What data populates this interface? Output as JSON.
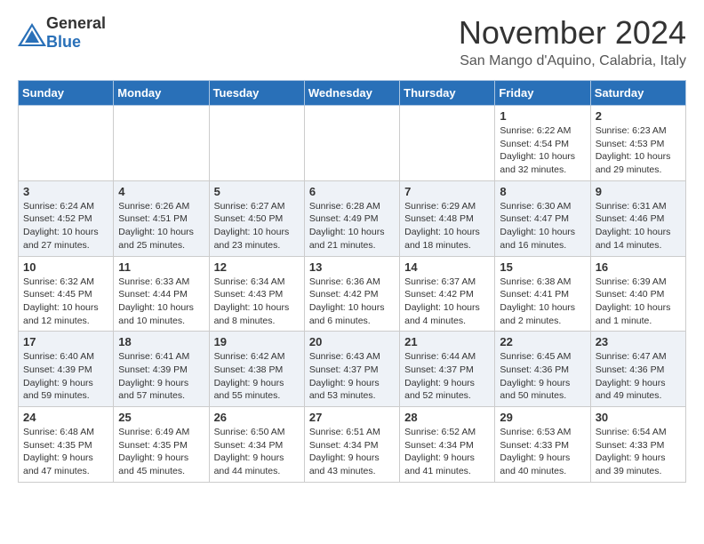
{
  "header": {
    "logo_general": "General",
    "logo_blue": "Blue",
    "month_title": "November 2024",
    "location": "San Mango d'Aquino, Calabria, Italy"
  },
  "calendar": {
    "columns": [
      "Sunday",
      "Monday",
      "Tuesday",
      "Wednesday",
      "Thursday",
      "Friday",
      "Saturday"
    ],
    "rows": [
      [
        {
          "day": "",
          "detail": ""
        },
        {
          "day": "",
          "detail": ""
        },
        {
          "day": "",
          "detail": ""
        },
        {
          "day": "",
          "detail": ""
        },
        {
          "day": "",
          "detail": ""
        },
        {
          "day": "1",
          "detail": "Sunrise: 6:22 AM\nSunset: 4:54 PM\nDaylight: 10 hours and 32 minutes."
        },
        {
          "day": "2",
          "detail": "Sunrise: 6:23 AM\nSunset: 4:53 PM\nDaylight: 10 hours and 29 minutes."
        }
      ],
      [
        {
          "day": "3",
          "detail": "Sunrise: 6:24 AM\nSunset: 4:52 PM\nDaylight: 10 hours and 27 minutes."
        },
        {
          "day": "4",
          "detail": "Sunrise: 6:26 AM\nSunset: 4:51 PM\nDaylight: 10 hours and 25 minutes."
        },
        {
          "day": "5",
          "detail": "Sunrise: 6:27 AM\nSunset: 4:50 PM\nDaylight: 10 hours and 23 minutes."
        },
        {
          "day": "6",
          "detail": "Sunrise: 6:28 AM\nSunset: 4:49 PM\nDaylight: 10 hours and 21 minutes."
        },
        {
          "day": "7",
          "detail": "Sunrise: 6:29 AM\nSunset: 4:48 PM\nDaylight: 10 hours and 18 minutes."
        },
        {
          "day": "8",
          "detail": "Sunrise: 6:30 AM\nSunset: 4:47 PM\nDaylight: 10 hours and 16 minutes."
        },
        {
          "day": "9",
          "detail": "Sunrise: 6:31 AM\nSunset: 4:46 PM\nDaylight: 10 hours and 14 minutes."
        }
      ],
      [
        {
          "day": "10",
          "detail": "Sunrise: 6:32 AM\nSunset: 4:45 PM\nDaylight: 10 hours and 12 minutes."
        },
        {
          "day": "11",
          "detail": "Sunrise: 6:33 AM\nSunset: 4:44 PM\nDaylight: 10 hours and 10 minutes."
        },
        {
          "day": "12",
          "detail": "Sunrise: 6:34 AM\nSunset: 4:43 PM\nDaylight: 10 hours and 8 minutes."
        },
        {
          "day": "13",
          "detail": "Sunrise: 6:36 AM\nSunset: 4:42 PM\nDaylight: 10 hours and 6 minutes."
        },
        {
          "day": "14",
          "detail": "Sunrise: 6:37 AM\nSunset: 4:42 PM\nDaylight: 10 hours and 4 minutes."
        },
        {
          "day": "15",
          "detail": "Sunrise: 6:38 AM\nSunset: 4:41 PM\nDaylight: 10 hours and 2 minutes."
        },
        {
          "day": "16",
          "detail": "Sunrise: 6:39 AM\nSunset: 4:40 PM\nDaylight: 10 hours and 1 minute."
        }
      ],
      [
        {
          "day": "17",
          "detail": "Sunrise: 6:40 AM\nSunset: 4:39 PM\nDaylight: 9 hours and 59 minutes."
        },
        {
          "day": "18",
          "detail": "Sunrise: 6:41 AM\nSunset: 4:39 PM\nDaylight: 9 hours and 57 minutes."
        },
        {
          "day": "19",
          "detail": "Sunrise: 6:42 AM\nSunset: 4:38 PM\nDaylight: 9 hours and 55 minutes."
        },
        {
          "day": "20",
          "detail": "Sunrise: 6:43 AM\nSunset: 4:37 PM\nDaylight: 9 hours and 53 minutes."
        },
        {
          "day": "21",
          "detail": "Sunrise: 6:44 AM\nSunset: 4:37 PM\nDaylight: 9 hours and 52 minutes."
        },
        {
          "day": "22",
          "detail": "Sunrise: 6:45 AM\nSunset: 4:36 PM\nDaylight: 9 hours and 50 minutes."
        },
        {
          "day": "23",
          "detail": "Sunrise: 6:47 AM\nSunset: 4:36 PM\nDaylight: 9 hours and 49 minutes."
        }
      ],
      [
        {
          "day": "24",
          "detail": "Sunrise: 6:48 AM\nSunset: 4:35 PM\nDaylight: 9 hours and 47 minutes."
        },
        {
          "day": "25",
          "detail": "Sunrise: 6:49 AM\nSunset: 4:35 PM\nDaylight: 9 hours and 45 minutes."
        },
        {
          "day": "26",
          "detail": "Sunrise: 6:50 AM\nSunset: 4:34 PM\nDaylight: 9 hours and 44 minutes."
        },
        {
          "day": "27",
          "detail": "Sunrise: 6:51 AM\nSunset: 4:34 PM\nDaylight: 9 hours and 43 minutes."
        },
        {
          "day": "28",
          "detail": "Sunrise: 6:52 AM\nSunset: 4:34 PM\nDaylight: 9 hours and 41 minutes."
        },
        {
          "day": "29",
          "detail": "Sunrise: 6:53 AM\nSunset: 4:33 PM\nDaylight: 9 hours and 40 minutes."
        },
        {
          "day": "30",
          "detail": "Sunrise: 6:54 AM\nSunset: 4:33 PM\nDaylight: 9 hours and 39 minutes."
        }
      ]
    ]
  }
}
